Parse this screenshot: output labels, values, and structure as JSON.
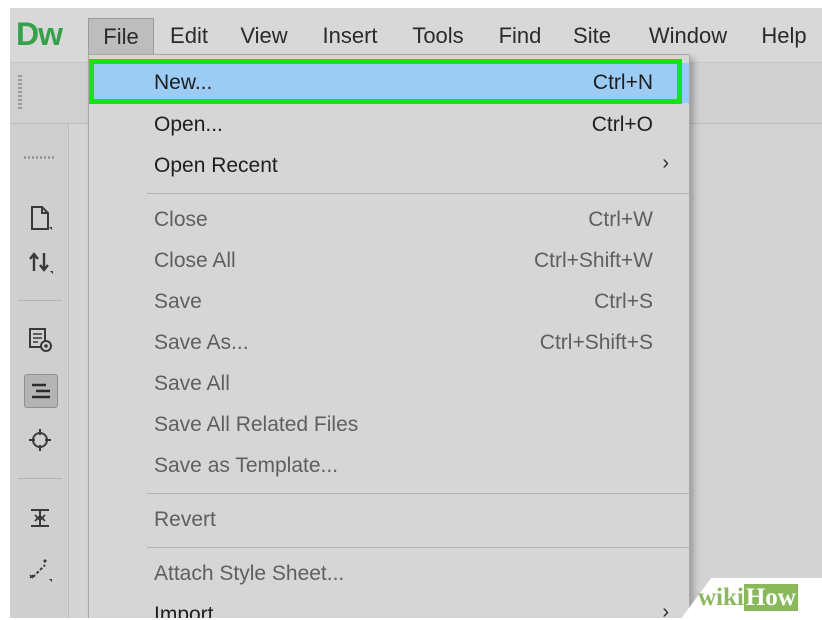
{
  "app": {
    "logo": "Dw"
  },
  "menubar": {
    "items": [
      {
        "label": "File",
        "active": true
      },
      {
        "label": "Edit"
      },
      {
        "label": "View"
      },
      {
        "label": "Insert"
      },
      {
        "label": "Tools"
      },
      {
        "label": "Find"
      },
      {
        "label": "Site"
      },
      {
        "label": "Window"
      },
      {
        "label": "Help"
      }
    ]
  },
  "file_menu": {
    "items": [
      {
        "label": "New...",
        "shortcut": "Ctrl+N",
        "state": "highlighted"
      },
      {
        "label": "Open...",
        "shortcut": "Ctrl+O",
        "state": "enabled"
      },
      {
        "label": "Open Recent",
        "submenu": true,
        "state": "enabled"
      },
      {
        "label": "Close",
        "shortcut": "Ctrl+W",
        "state": "disabled"
      },
      {
        "label": "Close All",
        "shortcut": "Ctrl+Shift+W",
        "state": "disabled"
      },
      {
        "label": "Save",
        "shortcut": "Ctrl+S",
        "state": "disabled"
      },
      {
        "label": "Save As...",
        "shortcut": "Ctrl+Shift+S",
        "state": "disabled"
      },
      {
        "label": "Save All",
        "state": "disabled"
      },
      {
        "label": "Save All Related Files",
        "state": "disabled"
      },
      {
        "label": "Save as Template...",
        "state": "disabled"
      },
      {
        "label": "Revert",
        "state": "disabled"
      },
      {
        "label": "Attach Style Sheet...",
        "state": "disabled"
      },
      {
        "label": "Import",
        "submenu": true,
        "state": "enabled"
      }
    ],
    "highlight_color": "#9ccbf3",
    "annotation_color": "#17e317"
  },
  "sidebar": {
    "icons": [
      "new-document-icon",
      "get-put-icon",
      "file-preview-icon",
      "code-format-icon",
      "target-icon",
      "expand-icon",
      "link-wand-icon"
    ]
  },
  "watermark": {
    "part1": "wiki",
    "part2": "How"
  },
  "colors": {
    "logo": "#35a14a",
    "watermark": "#8ab95c"
  }
}
